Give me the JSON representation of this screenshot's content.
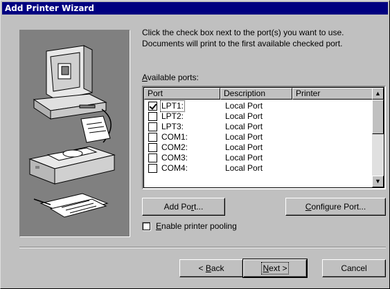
{
  "window": {
    "title": "Add Printer Wizard"
  },
  "instructions": {
    "line1": "Click the check box next to the port(s) you want to use.",
    "line2": "Documents will print to the first available checked port."
  },
  "available_ports_label": {
    "accel": "A",
    "rest": "vailable ports:"
  },
  "ports_table": {
    "columns": [
      "Port",
      "Description",
      "Printer"
    ],
    "rows": [
      {
        "port": "LPT1:",
        "description": "Local Port",
        "printer": "",
        "checked": true
      },
      {
        "port": "LPT2:",
        "description": "Local Port",
        "printer": "",
        "checked": false
      },
      {
        "port": "LPT3:",
        "description": "Local Port",
        "printer": "",
        "checked": false
      },
      {
        "port": "COM1:",
        "description": "Local Port",
        "printer": "",
        "checked": false
      },
      {
        "port": "COM2:",
        "description": "Local Port",
        "printer": "",
        "checked": false
      },
      {
        "port": "COM3:",
        "description": "Local Port",
        "printer": "",
        "checked": false
      },
      {
        "port": "COM4:",
        "description": "Local Port",
        "printer": "",
        "checked": false
      }
    ]
  },
  "buttons": {
    "add_port": {
      "pre": "Add Po",
      "accel": "r",
      "post": "t..."
    },
    "configure_port": {
      "pre": "",
      "accel": "C",
      "post": "onfigure Port..."
    },
    "back": {
      "pre": "< ",
      "accel": "B",
      "post": "ack"
    },
    "next": {
      "pre": "",
      "accel": "N",
      "post": "ext >"
    },
    "cancel": {
      "label": "Cancel"
    }
  },
  "pooling": {
    "accel": "E",
    "rest": "nable printer pooling",
    "checked": false
  },
  "icons": {
    "illustration": "computer-printer-illustration",
    "scroll_up": "scroll-up-arrow-icon",
    "scroll_down": "scroll-down-arrow-icon"
  },
  "colors": {
    "titlebar": "#000080",
    "face": "#c0c0c0",
    "illustration_bg": "#808080"
  }
}
